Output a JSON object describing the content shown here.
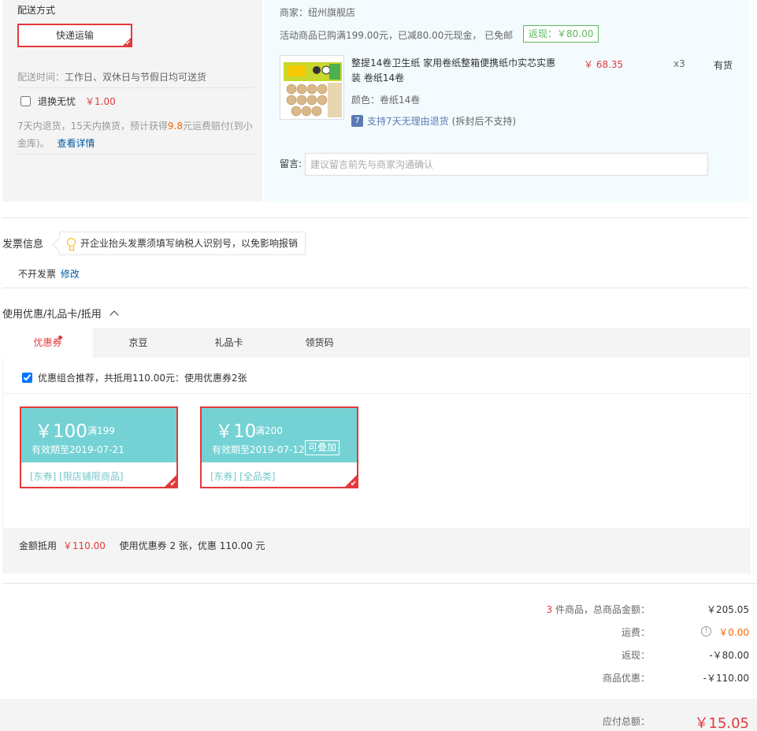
{
  "shipping": {
    "title": "配送方式",
    "method": "快递运输",
    "time_label": "配送时间：",
    "time_value": "工作日、双休日与节假日均可送货",
    "return_label": "退换无忧",
    "return_price": "￥1.00",
    "return_desc_a": "7天内退货，15天内换货，预计获得",
    "return_desc_amount": "9.8",
    "return_desc_b": "元运费赔付(到小金库)。",
    "return_link": "查看详情"
  },
  "store": {
    "seller": "商家：纽州旗舰店",
    "promo": "活动商品已购满199.00元，已减80.00元现金，  已免邮",
    "rebate": "返现：￥80.00",
    "product": {
      "name": "整提14卷卫生纸 家用卷纸整箱便携纸巾实芯实惠装 卷纸14卷",
      "price": "￥ 68.35",
      "qty": "x3",
      "stock": "有货",
      "color": "颜色：卷纸14卷",
      "return_icon": "7",
      "return_policy": "支持7天无理由退货",
      "return_note": "(拆封后不支持)"
    },
    "message_label": "留言:",
    "message_placeholder": "建议留言前先与商家沟通确认"
  },
  "invoice": {
    "title": "发票信息",
    "tip": "开企业抬头发票须填写纳税人识别号，以免影响报销",
    "value": "不开发票",
    "edit": "修改"
  },
  "coupon": {
    "title": "使用优惠/礼品卡/抵用",
    "tabs": [
      "优惠券",
      "京豆",
      "礼品卡",
      "领货码"
    ],
    "combo": "优惠组合推荐，共抵用110.00元：使用优惠券2张",
    "cards": [
      {
        "amount": "￥100",
        "cond": "满199",
        "expiry": "有效期至2019-07-21",
        "stack": "",
        "tags": "[东券]  [限店铺限商品]"
      },
      {
        "amount": "￥10",
        "cond": "满200",
        "expiry": "有效期至2019-07-12",
        "stack": "可叠加",
        "tags": "[东券]  [全品类]"
      }
    ],
    "summary_label": "金额抵用",
    "summary_amount": "￥110.00",
    "summary_text": "使用优惠券 2 张，优惠 110.00 元"
  },
  "totals": {
    "count": "3",
    "count_label": "件商品，总商品金额：",
    "goods": "￥205.05",
    "freight_label": "运费：",
    "freight": "￥0.00",
    "rebate_label": "返现：",
    "rebate": "-￥80.00",
    "discount_label": "商品优惠：",
    "discount": "-￥110.00",
    "grand_label": "应付总额：",
    "grand": "￥15.05"
  },
  "colors": {
    "accent": "#e4393c",
    "coupon": "#74d2d4",
    "rebate": "#5cb85c"
  }
}
